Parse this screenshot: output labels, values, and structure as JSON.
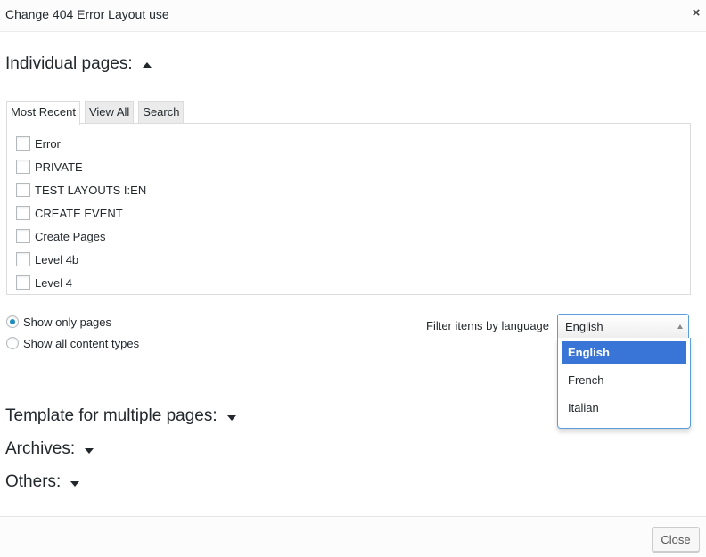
{
  "dialog": {
    "title": "Change 404 Error Layout use",
    "close_icon": "×"
  },
  "individual_pages": {
    "heading": "Individual pages:",
    "expanded": true,
    "tabs": [
      {
        "label": "Most Recent",
        "active": true
      },
      {
        "label": "View All",
        "active": false
      },
      {
        "label": "Search",
        "active": false
      }
    ],
    "items": [
      {
        "label": "Error",
        "checked": false
      },
      {
        "label": "PRIVATE",
        "checked": false
      },
      {
        "label": "TEST LAYOUTS I:EN",
        "checked": false
      },
      {
        "label": "CREATE EVENT",
        "checked": false
      },
      {
        "label": "Create Pages",
        "checked": false
      },
      {
        "label": "Level 4b",
        "checked": false
      },
      {
        "label": "Level 4",
        "checked": false
      }
    ],
    "content_filter": {
      "options": [
        {
          "label": "Show only pages",
          "checked": true
        },
        {
          "label": "Show all content types",
          "checked": false
        }
      ]
    },
    "language_filter": {
      "label": "Filter items by language",
      "selected": "English",
      "options": [
        "English",
        "French",
        "Italian"
      ]
    }
  },
  "sections": [
    {
      "heading": "Template for multiple pages:",
      "expanded": false
    },
    {
      "heading": "Archives:",
      "expanded": false
    },
    {
      "heading": "Others:",
      "expanded": false
    }
  ],
  "footer": {
    "close_label": "Close"
  },
  "colors": {
    "accent": "#1e8cbe",
    "selected_option": "#3875d7",
    "focus_border": "#5b9dd9"
  },
  "icons": {
    "expand": "caret-up-icon",
    "collapse": "caret-down-icon",
    "close": "close-icon"
  }
}
